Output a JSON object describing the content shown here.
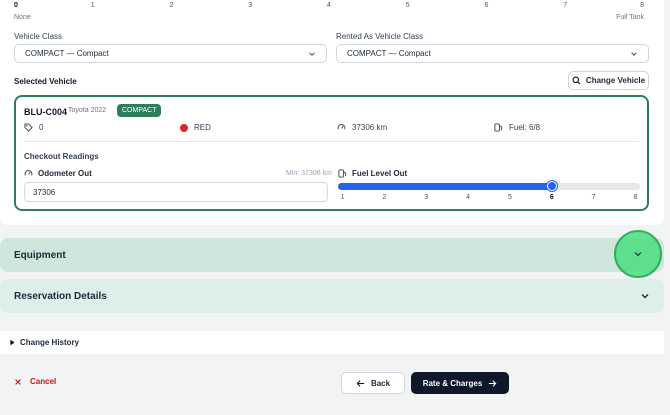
{
  "fuel_scale": {
    "ticks": [
      "0",
      "1",
      "2",
      "3",
      "4",
      "5",
      "6",
      "7",
      "8"
    ],
    "left_caption": "None",
    "right_caption": "Full Tank"
  },
  "vehicle_class": {
    "label": "Vehicle Class",
    "value": "COMPACT — Compact"
  },
  "rented_as": {
    "label": "Rented As Vehicle Class",
    "value": "COMPACT — Compact"
  },
  "selected_vehicle": {
    "title": "Selected Vehicle",
    "change_button": "Change Vehicle",
    "code": "BLU-C004",
    "model": "Toyota 2022",
    "class_badge": "COMPACT",
    "tag_count": "0",
    "color": "RED",
    "color_hex": "#dc2626",
    "mileage": "37306 km",
    "fuel": "Fuel: 6/8"
  },
  "checkout": {
    "title": "Checkout Readings",
    "odometer_label": "Odometer Out",
    "odometer_min": "Min: 37306 km",
    "odometer_value": "37306",
    "fuel_label": "Fuel Level Out",
    "fuel_ticks": [
      "1",
      "2",
      "3",
      "4",
      "5",
      "6",
      "7",
      "8"
    ],
    "fuel_level": 6,
    "fuel_max": 8
  },
  "sections": {
    "equipment": "Equipment",
    "reservation": "Reservation Details",
    "history": "Change History"
  },
  "footer": {
    "cancel": "Cancel",
    "back": "Back",
    "next": "Rate & Charges"
  },
  "colors": {
    "accent_green": "#2e7d5b",
    "slider_blue": "#2563eb",
    "primary_dark": "#0f172a",
    "cancel_red": "#b91c1c"
  }
}
